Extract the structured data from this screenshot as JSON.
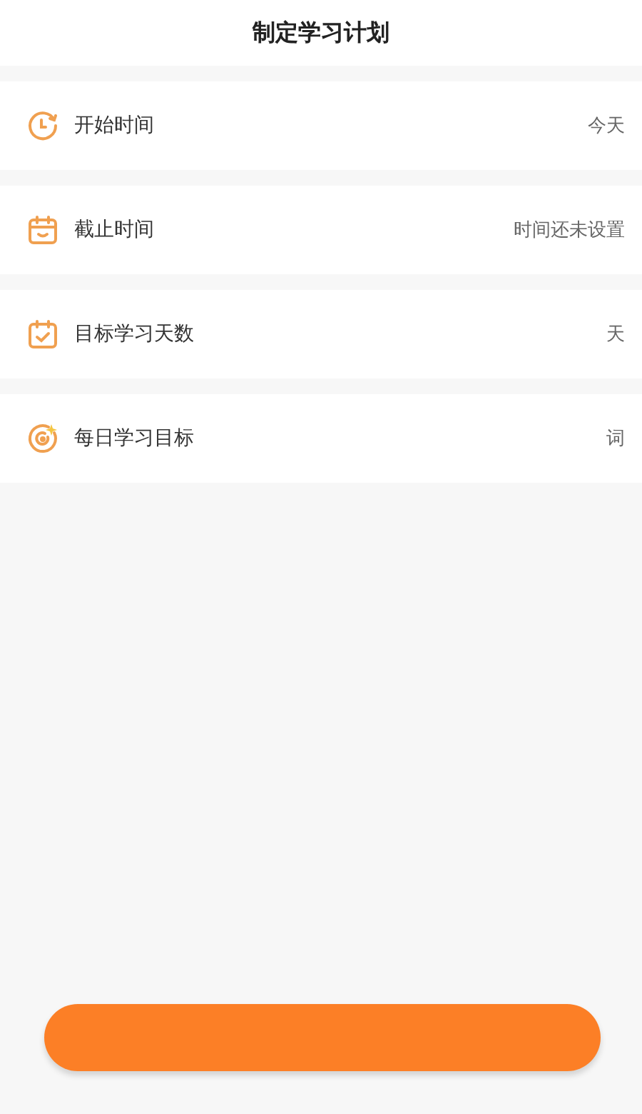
{
  "header": {
    "title": "制定学习计划"
  },
  "rows": [
    {
      "label": "开始时间",
      "value": "今天"
    },
    {
      "label": "截止时间",
      "value": "时间还未设置"
    },
    {
      "label": "目标学习天数",
      "value": "天"
    },
    {
      "label": "每日学习目标",
      "value": "词"
    }
  ]
}
